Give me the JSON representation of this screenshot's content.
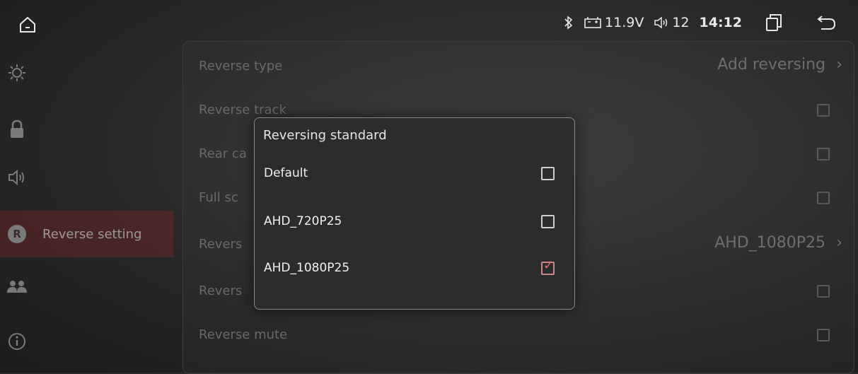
{
  "statusbar": {
    "voltage": "11.9V",
    "volume": "12",
    "time": "14:12"
  },
  "sidebar": {
    "active_label": "Reverse setting",
    "active_badge": "R"
  },
  "settings": {
    "rows": [
      {
        "label": "Reverse type",
        "value": "Add reversing",
        "control": "chevron"
      },
      {
        "label": "Reverse track",
        "control": "checkbox"
      },
      {
        "label": "Rear ca",
        "control": "checkbox"
      },
      {
        "label": "Full sc",
        "control": "checkbox"
      },
      {
        "label": "Revers",
        "value": "AHD_1080P25",
        "control": "chevron"
      },
      {
        "label": "Revers",
        "control": "checkbox"
      },
      {
        "label": "Reverse mute",
        "control": "checkbox"
      }
    ]
  },
  "dialog": {
    "title": "Reversing standard",
    "options": [
      {
        "label": "Default",
        "checked": false
      },
      {
        "label": "AHD_720P25",
        "checked": false
      },
      {
        "label": "AHD_1080P25",
        "checked": true
      }
    ]
  },
  "colors": {
    "accent_check": "#e06a6a",
    "active_sidebar": "#8c2828"
  },
  "icons": [
    "home-icon",
    "bluetooth-icon",
    "battery-icon",
    "volume-icon",
    "recent-apps-icon",
    "back-icon",
    "brightness-icon",
    "lock-icon",
    "speaker-icon",
    "reverse-r-icon",
    "users-icon",
    "info-icon"
  ]
}
